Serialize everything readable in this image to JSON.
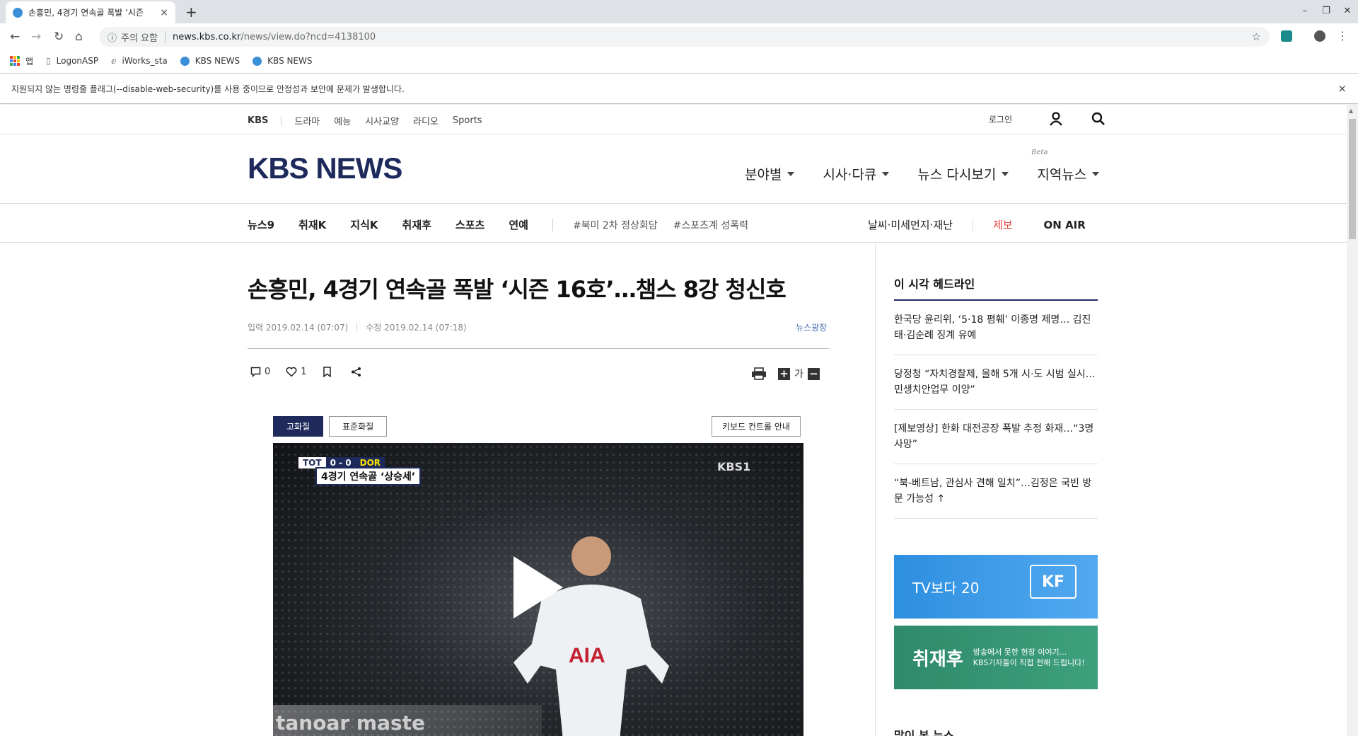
{
  "browser": {
    "tab_title": "손흥민, 4경기 연속골 폭발 ‘시즌",
    "tab_close": "×",
    "new_tab": "+",
    "window_controls": [
      "–",
      "❐",
      "✕"
    ],
    "nav": {
      "back": "←",
      "forward": "→",
      "reload": "↻",
      "home": "⌂"
    },
    "omnibox": {
      "info_icon": "ⓘ",
      "security_label": "주의 요함",
      "host": "news.kbs.co.kr",
      "path": "/news/view.do?ncd=4138100",
      "star": "☆"
    },
    "bookmarks": [
      {
        "label": "앱",
        "icon": "apps-grid-icon"
      },
      {
        "label": "LogonASP",
        "icon": "page-icon"
      },
      {
        "label": "iWorks_sta",
        "icon": "feather-icon"
      },
      {
        "label": "KBS NEWS",
        "icon": "globe-icon"
      },
      {
        "label": "KBS NEWS",
        "icon": "globe-icon"
      }
    ],
    "infobar_text": "지원되지 않는 명령줄 플래그(--disable-web-security)를 사용 중이므로 안정성과 보안에 문제가 발생합니다.",
    "infobar_close": "×"
  },
  "site": {
    "util": {
      "brand": "KBS",
      "services": [
        "드라마",
        "예능",
        "시사교양",
        "라디오",
        "Sports"
      ],
      "login": "로그인"
    },
    "logo": "KBS NEWS",
    "gnb": [
      {
        "label": "분야별"
      },
      {
        "label": "시사·다큐"
      },
      {
        "label": "뉴스 다시보기"
      },
      {
        "label": "지역뉴스",
        "badge": "Beta"
      }
    ],
    "subnav": {
      "items": [
        "뉴스9",
        "취재K",
        "지식K",
        "취재후",
        "스포츠",
        "연예"
      ],
      "hashtags": [
        "#북미 2차 정상회담",
        "#스포츠계 성폭력"
      ],
      "weather": "날씨·미세먼지·재난",
      "tip": "제보",
      "onair": "ON AIR"
    }
  },
  "article": {
    "title": "손흥민, 4경기 연속골 폭발 ‘시즌 16호’…챔스 8강 청신호",
    "input_date": "입력 2019.02.14 (07:07)",
    "modified_date": "수정 2019.02.14 (07:18)",
    "category": "뉴스광장",
    "comments": "0",
    "likes": "1",
    "font_label": "가",
    "quality_high": "고화질",
    "quality_std": "표준화질",
    "keyboard_guide": "키보드 컨트롤 안내",
    "video": {
      "score_home": "TOT",
      "score": "0 - 0",
      "score_away": "DOR",
      "caption": "4경기 연속골 ‘상승세’",
      "broadcaster": "KBS1",
      "adboard": "tanoar  maste"
    }
  },
  "sidebar": {
    "title": "이 시각 헤드라인",
    "headlines": [
      "한국당 윤리위, ‘5·18 폄훼’ 이종명 제명… 김진태·김순례 징계 유예",
      "당정청 “자치경찰제, 올해 5개 시·도 시범 실시…민생치안업무 이양”",
      "[제보영상] 한화 대전공장 폭발 추정 화재…“3명 사망”",
      "“북-베트남, 관심사 견해 일치”…김정은 국빈 방문 가능성 ↑"
    ],
    "banner_tv_text": "TV보다 20",
    "banner_tv_logo": "KF",
    "banner_cj_title": "취재후",
    "banner_cj_sub1": "방송에서 못한 현장 이야기...",
    "banner_cj_sub2": "KBS기자들이 직접 전해 드립니다!",
    "more_title": "많이 본 뉴스"
  },
  "colors": {
    "brand": "#1d2a5b",
    "tip": "#e2453a",
    "category": "#4a6fb0"
  }
}
